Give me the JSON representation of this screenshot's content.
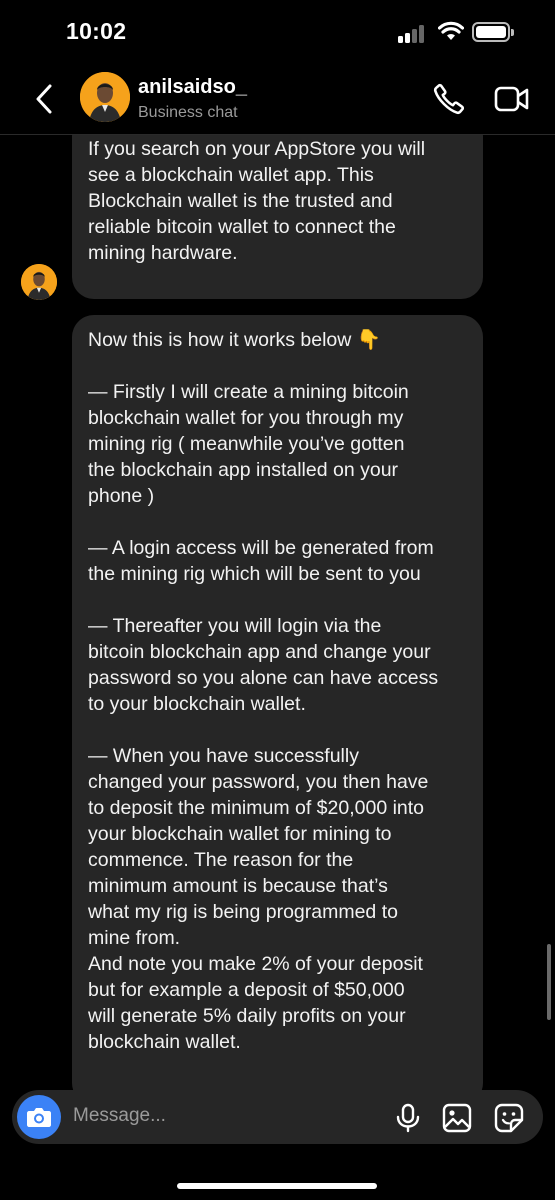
{
  "status": {
    "time": "10:02"
  },
  "header": {
    "name": "anilsaidso_",
    "subtitle": "Business chat"
  },
  "messages": [
    {
      "paragraphs": [
        "If you search on your AppStore you will\nsee a  blockchain wallet app. This\nBlockchain wallet is the trusted and\nreliable bitcoin wallet to connect the\nmining hardware."
      ]
    },
    {
      "paragraphs": [
        "Now this is how it works below 👇",
        "— Firstly I will create a mining bitcoin\nblockchain wallet for you through my\nmining rig ( meanwhile you’ve gotten\nthe blockchain app installed on your\nphone )",
        "— A login access will be generated from\nthe mining rig which will be sent to you",
        "— Thereafter you will login via the\nbitcoin blockchain app and change your\npassword so you alone can have access\nto your blockchain wallet.",
        "— When you have successfully\nchanged your password, you then have\nto deposit the minimum of $20,000 into\nyour blockchain wallet for mining to\ncommence.  The reason for the\nminimum amount is because that’s\nwhat my rig is being programmed to\nmine from.\nAnd note you make 2% of your deposit\nbut for example a deposit of $50,000\nwill generate 5% daily profits on your\nblockchain wallet."
      ]
    }
  ],
  "composer": {
    "placeholder": "Message..."
  },
  "icons": {
    "back": "chevron-left-icon",
    "call": "phone-icon",
    "video": "video-camera-icon",
    "camera": "camera-icon",
    "mic": "microphone-icon",
    "gallery": "image-gallery-icon",
    "sticker": "sticker-icon"
  },
  "colors": {
    "bubble": "#262626",
    "accent": "#3b82f6",
    "avatar": "#f6a21b"
  }
}
